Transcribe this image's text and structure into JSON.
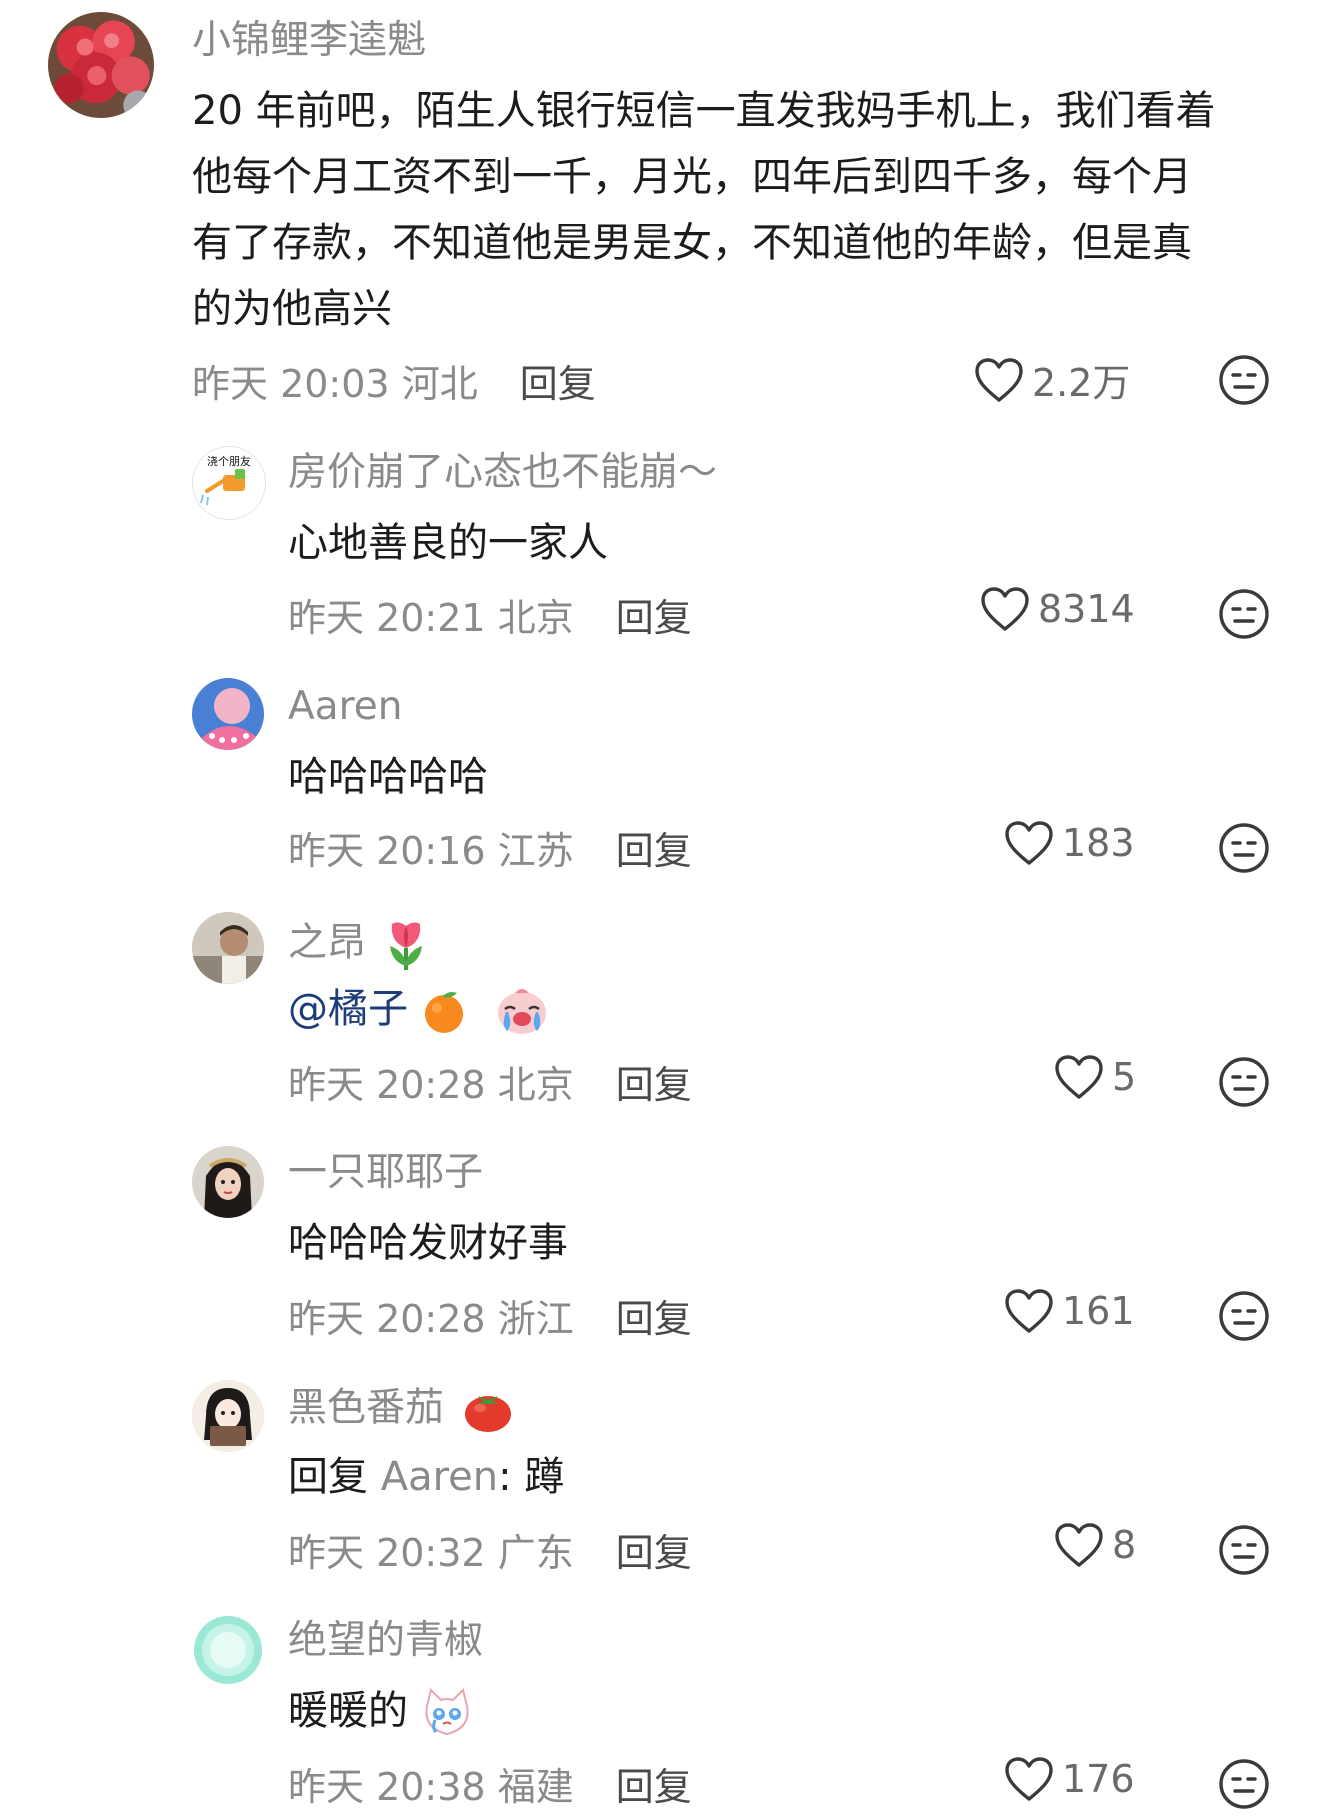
{
  "comments": [
    {
      "username": "小锦鲤李逵魁",
      "text_lines": [
        "20 年前吧，陌生人银行短信一直发我妈手机上，我们看着",
        "他每个月工资不到一千，月光，四年后到四千多，每个月",
        "有了存款，不知道他是男是女，不知道他的年龄，但是真",
        "的为他高兴"
      ],
      "time": "昨天 20:03",
      "location": "河北",
      "reply_label": "回复",
      "likes": "2.2万"
    },
    {
      "username": "房价崩了心态也不能崩～",
      "avatar_text": "浇个朋友",
      "text": "心地善良的一家人",
      "time": "昨天 20:21",
      "location": "北京",
      "reply_label": "回复",
      "likes": "8314"
    },
    {
      "username": "Aaren",
      "text": "哈哈哈哈哈",
      "time": "昨天 20:16",
      "location": "江苏",
      "reply_label": "回复",
      "likes": "183"
    },
    {
      "username": "之昂",
      "username_emoji": "tulip-emoji",
      "text": "@橘子",
      "text_emojis": [
        "orange-emoji",
        "crying-face-emoji"
      ],
      "time": "昨天 20:28",
      "location": "北京",
      "reply_label": "回复",
      "likes": "5"
    },
    {
      "username": "一只耶耶子",
      "text": "哈哈哈发财好事",
      "time": "昨天 20:28",
      "location": "浙江",
      "reply_label": "回复",
      "likes": "161"
    },
    {
      "username": "黑色番茄",
      "username_emoji": "tomato-emoji",
      "reply_prefix": "回复",
      "reply_target": "Aaren",
      "text": ": 蹲",
      "time": "昨天 20:32",
      "location": "广东",
      "reply_label": "回复",
      "likes": "8"
    },
    {
      "username": "绝望的青椒",
      "text": "暖暖的",
      "text_emojis": [
        "crying-cat-emoji"
      ],
      "time": "昨天 20:38",
      "location": "福建",
      "reply_label": "回复",
      "likes": "176"
    }
  ],
  "icons": {
    "like": "heart-outline-icon",
    "dislike": "neutral-face-icon"
  },
  "colors": {
    "meta_gray": "#8a8a8a",
    "text": "#1c1c1c",
    "mention": "#1d3d7a"
  }
}
